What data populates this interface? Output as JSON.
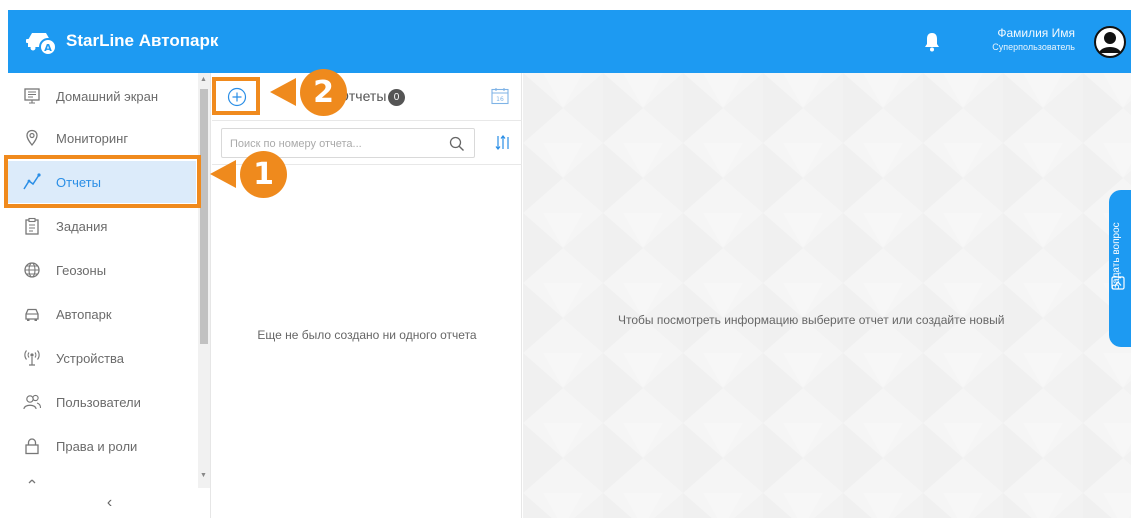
{
  "header": {
    "brand_prefix": "StarLine",
    "brand_suffix": "Автопарк",
    "user_name": "Фамилия Имя",
    "user_role": "Суперпользователь",
    "bg_color": "#1d9af2"
  },
  "sidebar": {
    "items": [
      {
        "label": "Домашний экран",
        "icon": "home-screen-icon"
      },
      {
        "label": "Мониторинг",
        "icon": "location-pin-icon"
      },
      {
        "label": "Отчеты",
        "icon": "chart-line-icon",
        "active": true
      },
      {
        "label": "Задания",
        "icon": "clipboard-icon"
      },
      {
        "label": "Геозоны",
        "icon": "globe-icon"
      },
      {
        "label": "Автопарк",
        "icon": "car-icon"
      },
      {
        "label": "Устройства",
        "icon": "antenna-icon"
      },
      {
        "label": "Пользователи",
        "icon": "users-icon"
      },
      {
        "label": "Права и роли",
        "icon": "lock-icon"
      }
    ],
    "collapse_label": "‹"
  },
  "callouts": {
    "one": "1",
    "two": "2",
    "color": "#ef8a1d"
  },
  "reports": {
    "title": "Отчеты",
    "count": "0",
    "search_placeholder": "Поиск по номеру отчета...",
    "empty_message": "Еще не было создано ни одного отчета"
  },
  "main": {
    "message": "Чтобы посмотреть информацию выберите отчет или создайте новый",
    "ask_label": "Задать вопрос"
  }
}
